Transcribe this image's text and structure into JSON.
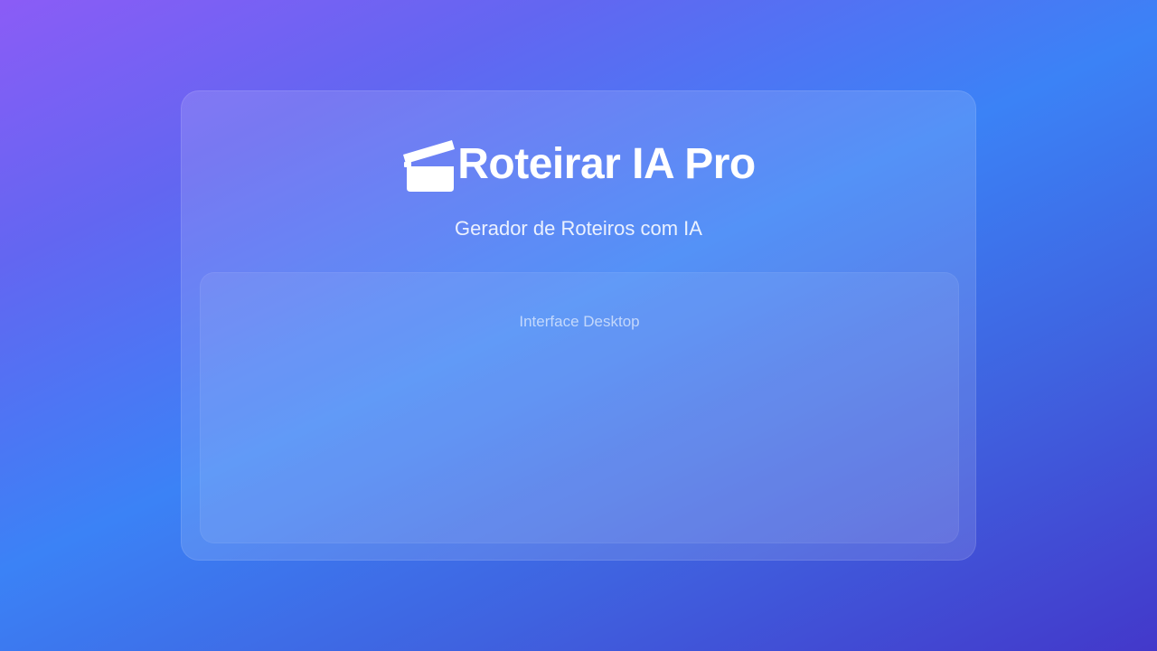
{
  "app": {
    "title": "Roteirar IA Pro",
    "subtitle": "Gerador de Roteiros com IA",
    "logo_icon": "clapperboard-icon"
  },
  "main": {
    "panel_label": "Interface Desktop"
  },
  "colors": {
    "gradient_start": "#8b5cf6",
    "gradient_mid": "#3b82f6",
    "gradient_end": "#4338ca",
    "text": "#ffffff"
  }
}
